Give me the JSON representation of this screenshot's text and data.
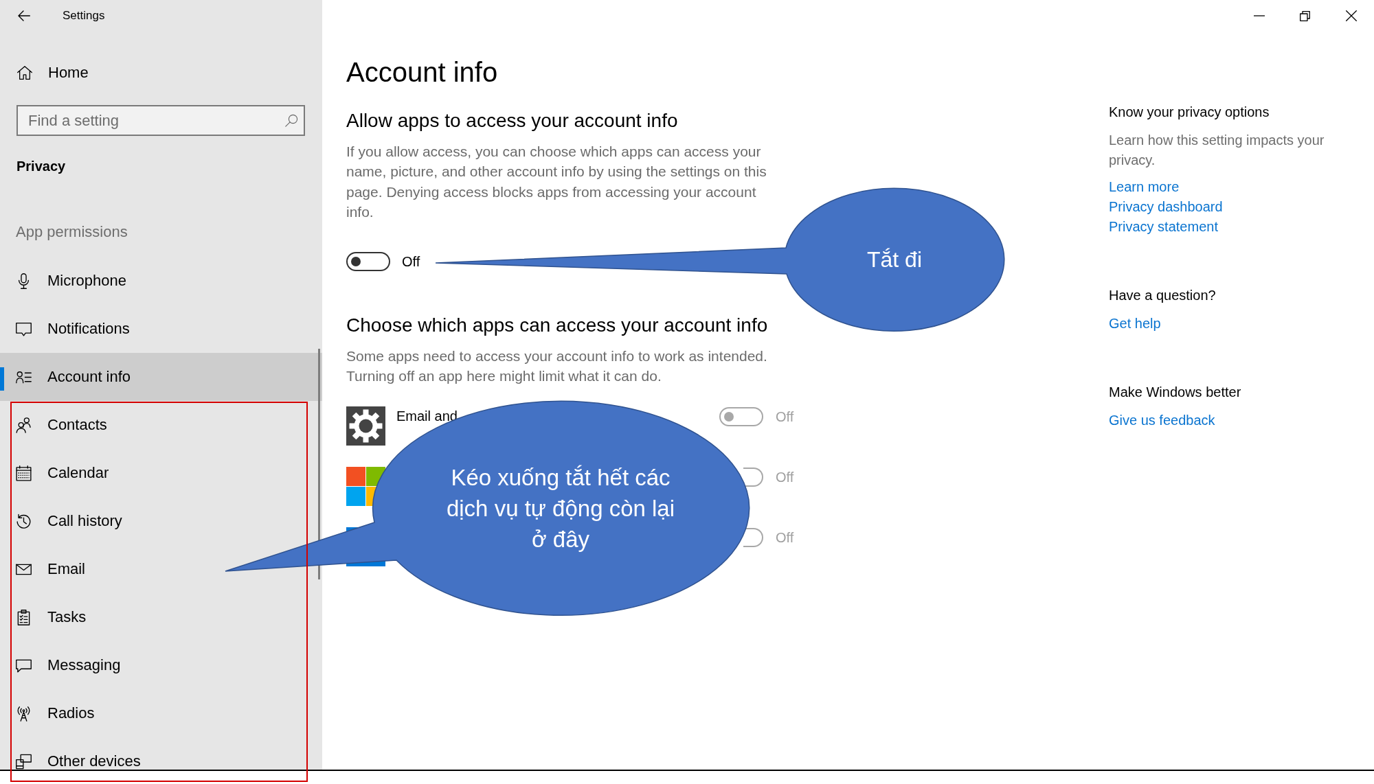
{
  "window": {
    "title": "Settings"
  },
  "sidebar": {
    "home": {
      "label": "Home"
    },
    "search": {
      "placeholder": "Find a setting"
    },
    "section_title": "Privacy",
    "group_title": "App permissions",
    "items": [
      {
        "label": "Microphone",
        "selected": false
      },
      {
        "label": "Notifications",
        "selected": false
      },
      {
        "label": "Account info",
        "selected": true
      },
      {
        "label": "Contacts",
        "selected": false
      },
      {
        "label": "Calendar",
        "selected": false
      },
      {
        "label": "Call history",
        "selected": false
      },
      {
        "label": "Email",
        "selected": false
      },
      {
        "label": "Tasks",
        "selected": false
      },
      {
        "label": "Messaging",
        "selected": false
      },
      {
        "label": "Radios",
        "selected": false
      },
      {
        "label": "Other devices",
        "selected": false
      }
    ]
  },
  "page": {
    "title": "Account info",
    "access": {
      "heading": "Allow apps to access your account info",
      "description": "If you allow access, you can choose which apps can access your name, picture, and other account info by using the settings on this page. Denying access blocks apps from accessing your account info.",
      "toggle": {
        "on": false,
        "disabled": false,
        "state_text": "Off"
      }
    },
    "apps": {
      "heading": "Choose which apps can access your account info",
      "description": "Some apps need to access your account info to work as intended. Turning off an app here might limit what it can do.",
      "items": [
        {
          "name": "Email and",
          "toggle": {
            "on": false,
            "disabled": true,
            "state_text": "Off"
          }
        },
        {
          "toggle": {
            "on": false,
            "disabled": true,
            "state_text": "Off"
          }
        },
        {
          "toggle": {
            "on": false,
            "disabled": true,
            "state_text": "Off"
          }
        }
      ]
    }
  },
  "aside": {
    "groups": [
      {
        "heading": "Know your privacy options",
        "text": "Learn how this setting impacts your privacy.",
        "links": [
          "Learn more",
          "Privacy dashboard",
          "Privacy statement"
        ]
      },
      {
        "heading": "Have a question?",
        "links": [
          "Get help"
        ]
      },
      {
        "heading": "Make Windows better",
        "links": [
          "Give us feedback"
        ]
      }
    ]
  },
  "callouts": [
    {
      "text": "Tắt đi"
    },
    {
      "text": "Kéo xuống tắt hết các dịch vụ tự động còn lại ở đây"
    }
  ]
}
